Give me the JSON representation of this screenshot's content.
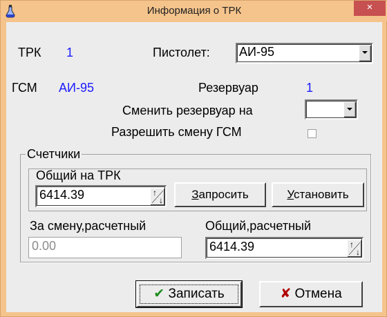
{
  "window": {
    "title": "Информация о ТРК",
    "close_glyph": "×"
  },
  "trk": {
    "label": "ТРК",
    "value": "1"
  },
  "pistol": {
    "label": "Пистолет:",
    "value": "АИ-95"
  },
  "gsm": {
    "label": "ГСМ",
    "value": "АИ-95"
  },
  "reservoir": {
    "label": "Резервуар",
    "value": "1"
  },
  "change_reservoir": {
    "label": "Сменить резервуар на",
    "value": ""
  },
  "allow_change": {
    "label": "Разрешить смену ГСМ",
    "checked": false
  },
  "counters": {
    "group_label": "Счетчики",
    "total_trk_label": "Общий на ТРК",
    "total_trk_value": "6414.39",
    "request_button": {
      "underline": "З",
      "rest": "апросить"
    },
    "set_button": {
      "underline": "У",
      "rest": "становить"
    },
    "shift_calc_label": "За смену,расчетный",
    "shift_calc_value": "0.00",
    "total_calc_label": "Общий,расчетный",
    "total_calc_value": "6414.39"
  },
  "buttons": {
    "save": {
      "icon": "✔",
      "label": "Записать"
    },
    "cancel": {
      "icon": "✘",
      "label": "Отмена"
    }
  },
  "colors": {
    "title_bar": "#f5c48c",
    "client": "#ececec",
    "value_blue": "#1a1aff",
    "close": "#c75050",
    "save_check": "#1e8c1e",
    "cancel_x": "#b00000"
  },
  "icons": [
    "app-flask-icon",
    "close-icon",
    "dropdown-arrow-icon",
    "spinner-icon",
    "checkmark-icon",
    "cross-icon"
  ]
}
